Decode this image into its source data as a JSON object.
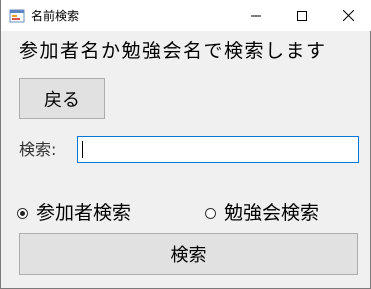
{
  "window": {
    "title": "名前検索"
  },
  "content": {
    "heading": "参加者名か勉強会名で検索します",
    "back_button_label": "戻る",
    "search_label": "検索:",
    "search_value": "",
    "radio_participant_label": "参加者検索",
    "radio_study_label": "勉強会検索",
    "selected_radio": "参加者検索",
    "search_button_label": "検索"
  },
  "icons": {
    "app": "app-form-icon",
    "minimize": "minimize-icon",
    "maximize": "maximize-icon",
    "close": "close-icon"
  }
}
